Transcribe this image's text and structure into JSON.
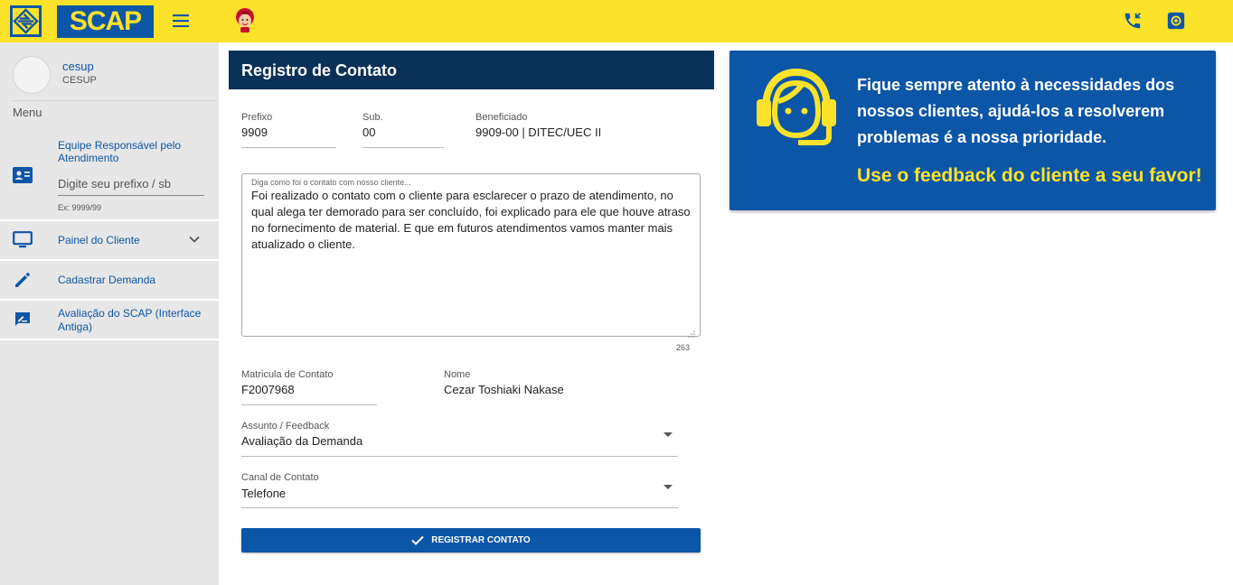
{
  "header": {
    "app_name": "SCAP",
    "icons": [
      "bb-logo-icon",
      "menu-icon",
      "mascot-icon",
      "phone-icon",
      "gear-icon"
    ],
    "colors": {
      "bar": "#fce22b",
      "brand_blue": "#0c56a7"
    }
  },
  "sidebar": {
    "user_name": "cesup",
    "user_org": "CESUP",
    "menu_label": "Menu",
    "equipe_label": "Equipe Responsável pelo Atendimento",
    "prefix_placeholder": "Digite seu prefixo / sb",
    "prefix_hint": "Ex: 9999/99",
    "items": [
      {
        "label": "Painel do Cliente",
        "icon": "monitor-icon",
        "expandable": true
      },
      {
        "label": "Cadastrar Demanda",
        "icon": "pencil-icon"
      },
      {
        "label": "Avaliação do SCAP (Interface Antiga)",
        "icon": "rate-review-icon"
      }
    ]
  },
  "form": {
    "title": "Registro de Contato",
    "prefixo_label": "Prefixo",
    "prefixo_value": "9909",
    "sub_label": "Sub.",
    "sub_value": "00",
    "beneficiado_label": "Beneficiado",
    "beneficiado_value": "9909-00 | DITEC/UEC II",
    "textarea_label": "Diga como foi o contato com nosso cliente...",
    "textarea_value": "Foi realizado o contato com o cliente para esclarecer o prazo de atendimento, no qual alega ter demorado para ser concluído, foi explicado para ele que houve atraso no fornecimento de material. E que em futuros atendimentos vamos manter mais atualizado o cliente.",
    "char_count": "263",
    "matricula_label": "Matricula de Contato",
    "matricula_value": "F2007968",
    "nome_label": "Nome",
    "nome_value": "Cezar Toshiaki Nakase",
    "assunto_label": "Assunto / Feedback",
    "assunto_value": "Avaliação da Demanda",
    "canal_label": "Canal de Contato",
    "canal_value": "Telefone",
    "submit_label": "REGISTRAR CONTATO"
  },
  "banner": {
    "text": "Fique sempre atento à necessidades dos nossos clientes, ajudá-los a resolverem problemas é a nossa prioridade.",
    "cta": "Use o feedback do cliente a seu favor!",
    "icon": "headset-support-icon",
    "colors": {
      "background": "#0c56a7",
      "cta": "#fce22b"
    }
  }
}
